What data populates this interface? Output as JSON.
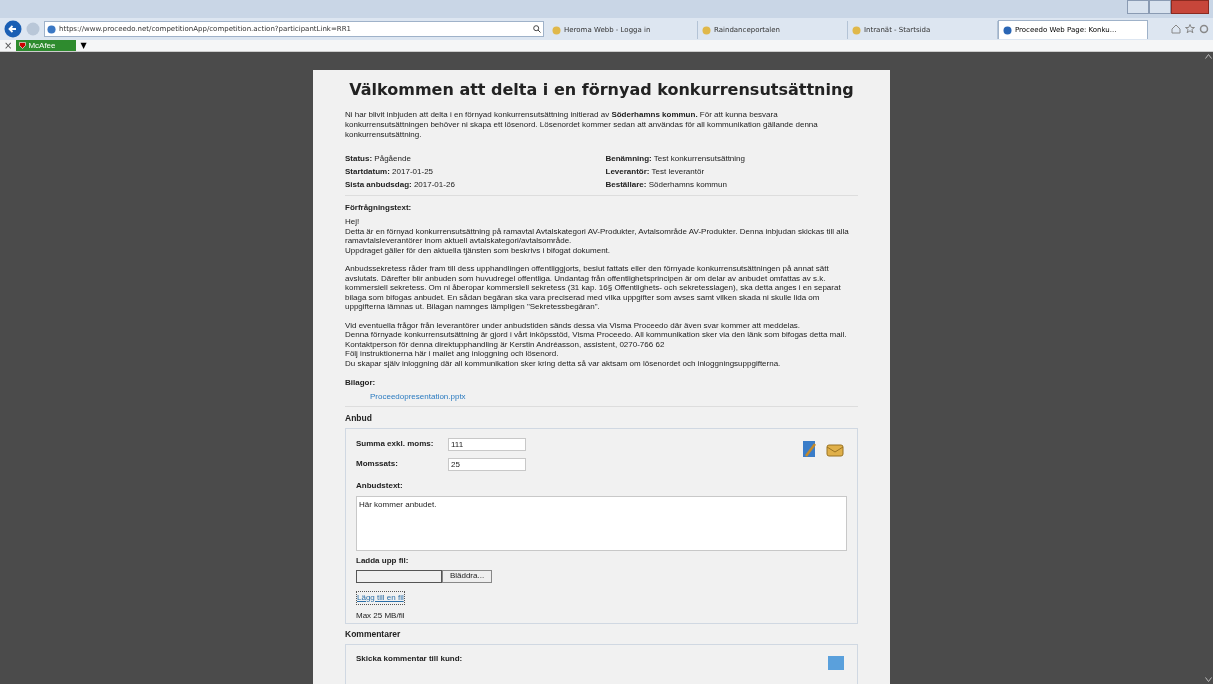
{
  "browser": {
    "address": "https://www.proceedo.net/competitionApp/competition.action?participantLink=RR1",
    "tabs": [
      {
        "label": "Heroma Webb - Logga in",
        "selected": false
      },
      {
        "label": "Raindanceportalen",
        "selected": false
      },
      {
        "label": "Intranät - Startsida",
        "selected": false
      },
      {
        "label": "Proceedo Web Page: Konku...",
        "selected": true
      }
    ],
    "toolbar": {
      "close": "×",
      "addon": "McAfee",
      "dropdown": "▼"
    }
  },
  "page": {
    "title": "Välkommen att delta i en förnyad konkurrensutsättning",
    "intro": "Ni har blivit inbjuden att delta i en förnyad konkurrensutsättning initierad av **Söderhamns kommun.** För att kunna besvara konkurrensutsättningen behöver ni skapa ett lösenord. Lösenordet kommer sedan att användas för all kommunikation gällande denna konkurrensutsättning.",
    "info_left": [
      {
        "label": "Status:",
        "value": "Pågående"
      },
      {
        "label": "Startdatum:",
        "value": "2017-01-25"
      },
      {
        "label": "Sista anbudsdag:",
        "value": "2017-01-26"
      }
    ],
    "info_right": [
      {
        "label": "Benämning:",
        "value": "Test konkurrensutsättning"
      },
      {
        "label": "Leverantör:",
        "value": "Test leverantör"
      },
      {
        "label": "Beställare:",
        "value": "Söderhamns kommun"
      }
    ],
    "inquiry_heading": "Förfrågningstext:",
    "inquiry": [
      [
        "Hej!",
        "Detta är en förnyad konkurrensutsättning på ramavtal Avtalskategori AV-Produkter, Avtalsområde AV-Produkter. Denna inbjudan skickas till alla ramavtalsleverantörer inom aktuell avtalskategori/avtalsområde.",
        "Uppdraget gäller för den aktuella tjänsten som beskrivs i bifogat dokument."
      ],
      [
        "Anbudssekretess råder fram till dess upphandlingen offentliggjorts, beslut fattats eller den förnyade konkurrensutsättningen på annat sätt avslutats. Därefter blir anbuden som huvudregel offentliga. Undantag från offentlighetsprincipen är om delar av anbudet omfattas av s.k. kommersiell sekretess. Om ni åberopar kommersiell sekretess (31 kap. 16§ Offentlighets- och sekretesslagen), ska detta anges i en separat bilaga som bifogas anbudet. En sådan begäran ska vara preciserad med vilka uppgifter som avses samt vilken skada ni skulle lida om uppgifterna lämnas ut. Bilagan namnges lämpligen \"Sekretessbegäran\"."
      ],
      [
        "Vid eventuella frågor från leverantörer under anbudstiden sänds dessa via Visma Proceedo där även svar kommer att meddelas.",
        "Denna förnyade konkurrensutsättning är gjord i vårt inköpsstöd, Visma Proceedo. All kommunikation sker via den länk som bifogas detta mail.",
        "Kontaktperson för denna direktupphandling är Kerstin Andréasson, assistent, 0270-766 62",
        "Följ instruktionerna här i mailet ang inloggning och lösenord.",
        "Du skapar själv inloggning där all kommunikation sker kring detta så var aktsam om lösenordet och inloggningsuppgifterna."
      ]
    ],
    "attachments_heading": "Bilagor:",
    "attachments": [
      "Proceedopresentation.pptx"
    ],
    "bid": {
      "heading": "Anbud",
      "fields": [
        {
          "label": "Summa exkl. moms:",
          "value": "111"
        },
        {
          "label": "Momssats:",
          "value": "25"
        }
      ],
      "text_label": "Anbudstext:",
      "text_value": "Här kommer anbudet.",
      "upload_label": "Ladda upp fil:",
      "browse_button": "Bläddra...",
      "add_file_link": "Lägg till en fil",
      "max_note": "Max 25 MB/fil"
    },
    "comments": {
      "heading": "Kommentarer",
      "send_label": "Skicka kommentar till kund:"
    }
  }
}
